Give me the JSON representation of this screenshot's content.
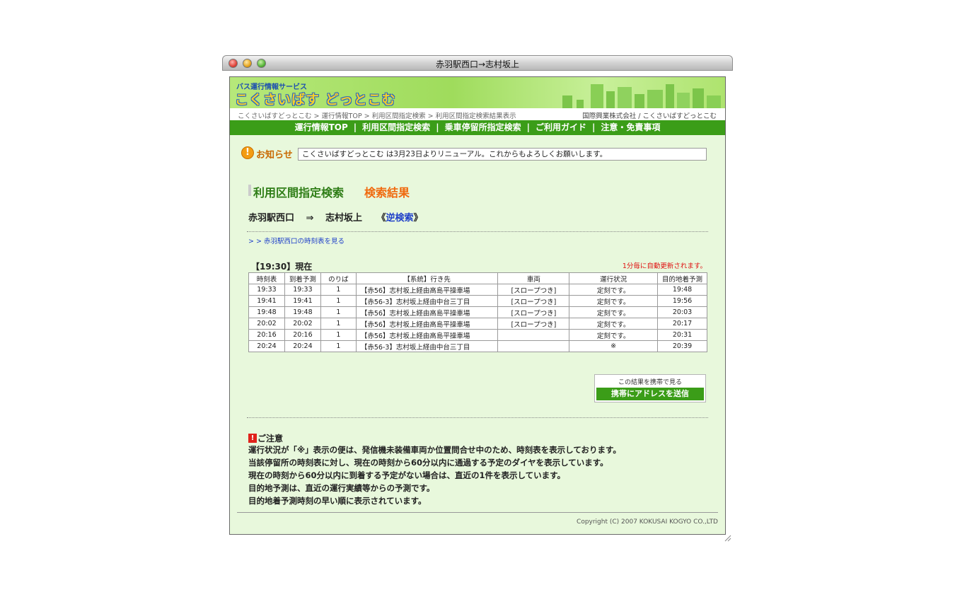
{
  "window": {
    "title": "赤羽駅西口→志村坂上"
  },
  "banner": {
    "service_label": "バス運行情報サービス",
    "brand": "こくさいばす どっとこむ"
  },
  "breadcrumb": {
    "items": [
      "こくさいばすどっとこむ",
      "運行情報TOP",
      "利用区間指定検索",
      "利用区間指定検索結果表示"
    ],
    "separator": ">",
    "right": "国際興業株式会社 / こくさいばすどっとこむ"
  },
  "nav": {
    "items": [
      "運行情報TOP",
      "利用区間指定検索",
      "乗車停留所指定検索",
      "ご利用ガイド",
      "注意・免責事項"
    ],
    "separator": "|"
  },
  "notice": {
    "label": "お知らせ",
    "text": "こくさいばすどっとこむ は3月23日よりリニューアル。これからもよろしくお願いします。"
  },
  "section": {
    "title": "利用区間指定検索",
    "subtitle": "検索結果"
  },
  "route": {
    "from": "赤羽駅西口",
    "arrow": "⇒",
    "to": "志村坂上",
    "reverse_open": "《",
    "reverse_link": "逆検索",
    "reverse_close": "》"
  },
  "timetable_link": "> > 赤羽駅西口の時刻表を見る",
  "status": {
    "now": "【19:30】現在",
    "auto_update": "1分毎に自動更新されます。"
  },
  "table": {
    "headers": [
      "時刻表",
      "到着予測",
      "のりば",
      "【系統】行き先",
      "車両",
      "運行状況",
      "目的地着予測"
    ],
    "rows": [
      [
        "19:33",
        "19:33",
        "1",
        "【赤56】志村坂上経由高島平操車場",
        "[スロープつき]",
        "定刻です。",
        "19:48"
      ],
      [
        "19:41",
        "19:41",
        "1",
        "【赤56-3】志村坂上経由中台三丁目",
        "[スロープつき]",
        "定刻です。",
        "19:56"
      ],
      [
        "19:48",
        "19:48",
        "1",
        "【赤56】志村坂上経由高島平操車場",
        "[スロープつき]",
        "定刻です。",
        "20:03"
      ],
      [
        "20:02",
        "20:02",
        "1",
        "【赤56】志村坂上経由高島平操車場",
        "[スロープつき]",
        "定刻です。",
        "20:17"
      ],
      [
        "20:16",
        "20:16",
        "1",
        "【赤56】志村坂上経由高島平操車場",
        "",
        "定刻です。",
        "20:31"
      ],
      [
        "20:24",
        "20:24",
        "1",
        "【赤56-3】志村坂上経由中台三丁目",
        "",
        "※",
        "20:39"
      ]
    ]
  },
  "mobile": {
    "caption": "この結果を携帯で見る",
    "button": "携帯にアドレスを送信"
  },
  "caution": {
    "title": "ご注意",
    "lines": [
      "運行状況が「※」表示の便は、発信機未装備車両か位置問合せ中のため、時刻表を表示しております。",
      "当該停留所の時刻表に対し、現在の時刻から60分以内に通過する予定のダイヤを表示しています。",
      "現在の時刻から60分以内に到着する予定がない場合は、直近の1件を表示しています。",
      "目的地予測は、直近の運行実績等からの予測です。",
      "目的地着予測時刻の早い順に表示されています。"
    ]
  },
  "footer": {
    "copyright": "Copyright (C) 2007 KOKUSAI KOGYO CO.,LTD"
  },
  "colors": {
    "nav_green": "#3b9d18",
    "page_bg": "#e8f8dc",
    "accent_orange": "#f06a0f",
    "link_blue": "#1e3fc9",
    "alert_red": "#e01010"
  }
}
